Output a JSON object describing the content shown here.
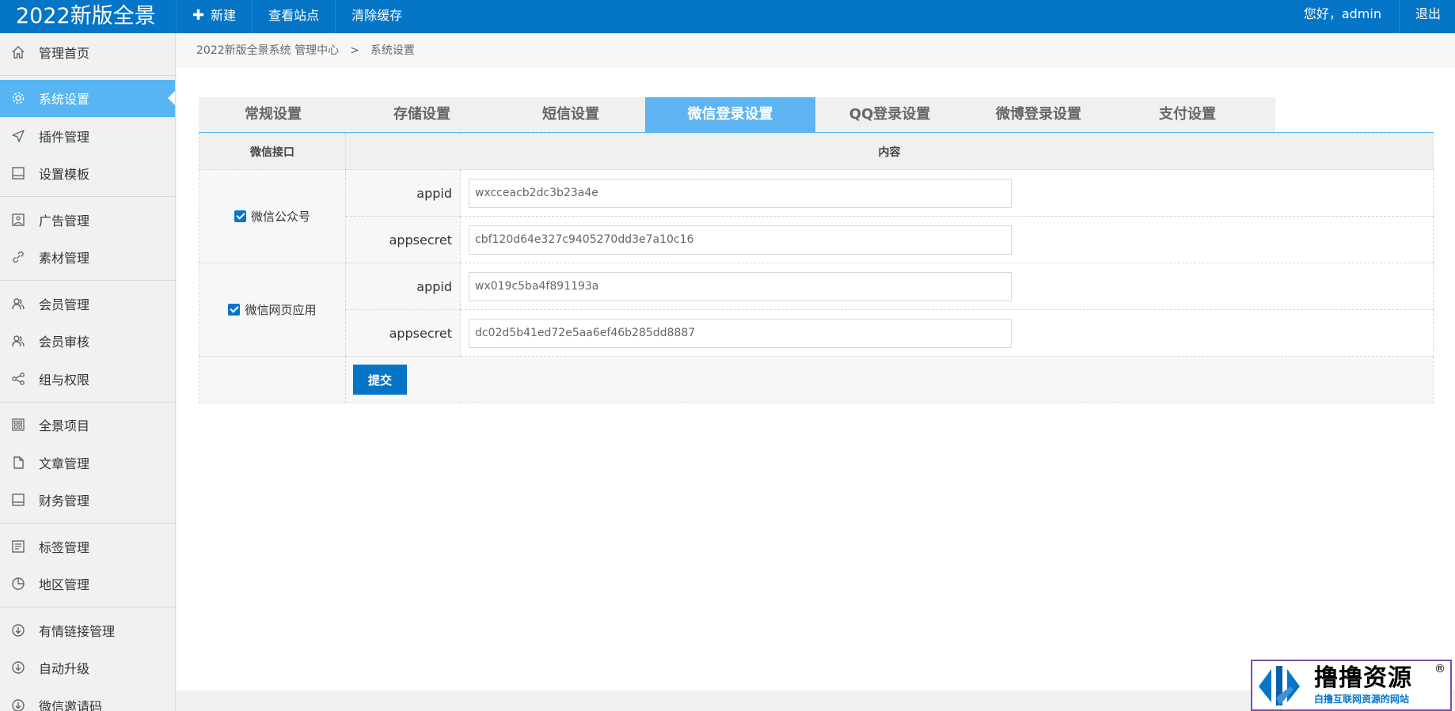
{
  "header": {
    "brand": "2022新版全景",
    "nav": [
      {
        "label": "新建",
        "icon": "plus-icon"
      },
      {
        "label": "查看站点"
      },
      {
        "label": "清除缓存"
      }
    ],
    "greeting": "您好，admin",
    "logout": "退出"
  },
  "sidebar": {
    "items": [
      {
        "label": "管理首页",
        "icon": "home-icon"
      },
      {
        "label": "系统设置",
        "icon": "gear-icon",
        "active": true
      },
      {
        "label": "插件管理",
        "icon": "send-icon"
      },
      {
        "label": "设置模板",
        "icon": "template-icon"
      },
      {
        "label": "广告管理",
        "icon": "image-icon"
      },
      {
        "label": "素材管理",
        "icon": "link-icon"
      },
      {
        "label": "会员管理",
        "icon": "users-icon"
      },
      {
        "label": "会员审核",
        "icon": "users-icon"
      },
      {
        "label": "组与权限",
        "icon": "share-icon"
      },
      {
        "label": "全景项目",
        "icon": "grid-icon"
      },
      {
        "label": "文章管理",
        "icon": "file-icon"
      },
      {
        "label": "财务管理",
        "icon": "template-icon"
      },
      {
        "label": "标签管理",
        "icon": "list-icon"
      },
      {
        "label": "地区管理",
        "icon": "pie-icon"
      },
      {
        "label": "有情链接管理",
        "icon": "download-circle-icon"
      },
      {
        "label": "自动升级",
        "icon": "download-circle-icon"
      },
      {
        "label": "微信邀请码",
        "icon": "download-circle-icon"
      }
    ]
  },
  "breadcrumb": {
    "root": "2022新版全景系统 管理中心",
    "separator": ">",
    "current": "系统设置"
  },
  "tabs": [
    {
      "label": "常规设置"
    },
    {
      "label": "存储设置"
    },
    {
      "label": "短信设置"
    },
    {
      "label": "微信登录设置",
      "active": true
    },
    {
      "label": "QQ登录设置"
    },
    {
      "label": "微博登录设置"
    },
    {
      "label": "支付设置"
    }
  ],
  "table": {
    "col_interface": "微信接口",
    "col_content": "内容",
    "groups": [
      {
        "name": "微信公众号",
        "checked": true,
        "fields": [
          {
            "label": "appid",
            "value": "wxcceacb2dc3b23a4e"
          },
          {
            "label": "appsecret",
            "value": "cbf120d64e327c9405270dd3e7a10c16"
          }
        ]
      },
      {
        "name": "微信网页应用",
        "checked": true,
        "fields": [
          {
            "label": "appid",
            "value": "wx019c5ba4f891193a"
          },
          {
            "label": "appsecret",
            "value": "dc02d5b41ed72e5aa6ef46b285dd8887"
          }
        ]
      }
    ],
    "submit": "提交"
  },
  "watermark": {
    "title": "撸撸资源",
    "subtitle": "白撸互联网资源的网站",
    "reg": "®"
  },
  "colors": {
    "primary": "#0575c8",
    "active_tab": "#5db4f1",
    "active_sidebar": "#56b5f2"
  }
}
